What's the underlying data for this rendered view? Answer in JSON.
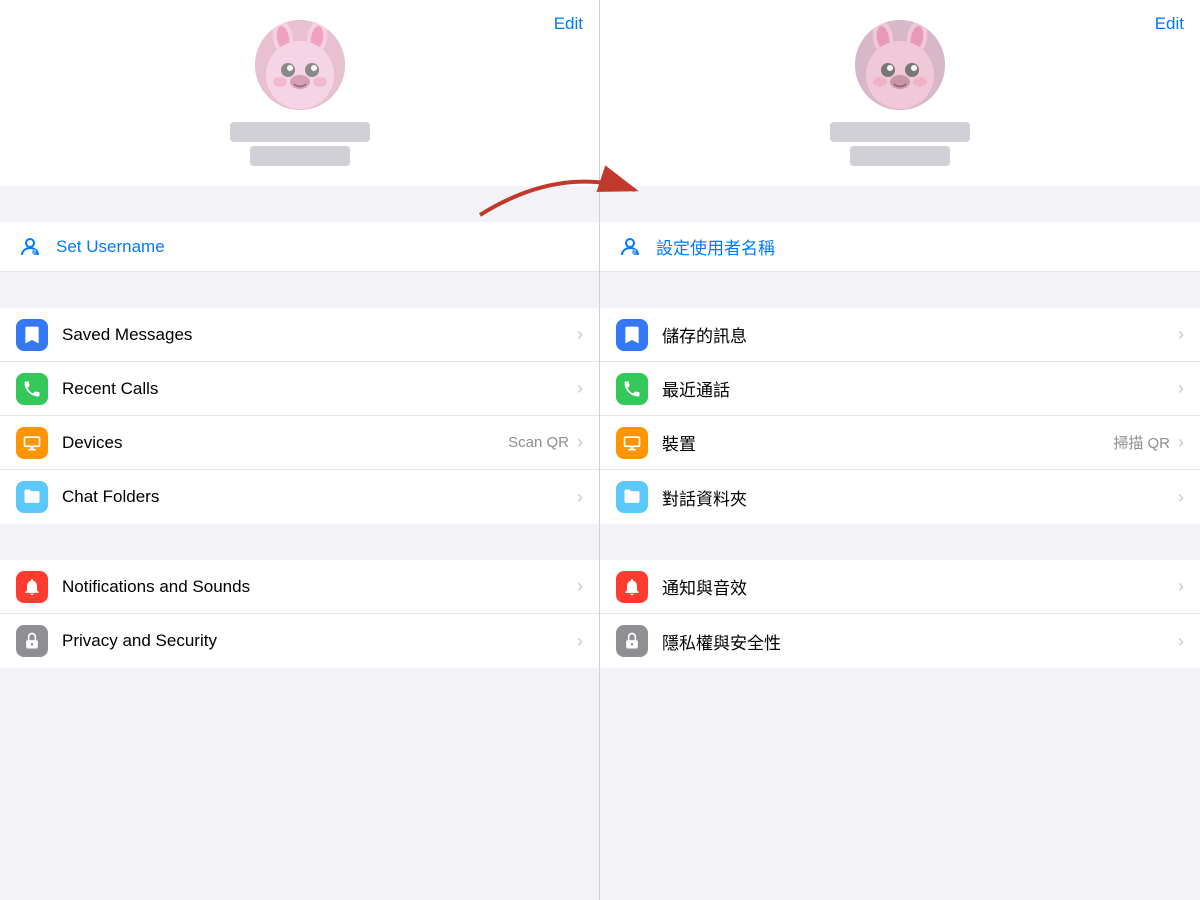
{
  "left": {
    "edit_label": "Edit",
    "username_icon": "👤",
    "username_label": "Set Username",
    "menu_groups": [
      {
        "items": [
          {
            "id": "saved-messages",
            "label": "Saved Messages",
            "icon_class": "icon-blue",
            "icon": "bookmark",
            "accessory": ""
          },
          {
            "id": "recent-calls",
            "label": "Recent Calls",
            "icon_class": "icon-green",
            "icon": "phone",
            "accessory": ""
          },
          {
            "id": "devices",
            "label": "Devices",
            "icon_class": "icon-orange",
            "icon": "laptop",
            "accessory": "Scan QR"
          },
          {
            "id": "chat-folders",
            "label": "Chat Folders",
            "icon_class": "icon-teal",
            "icon": "folder",
            "accessory": ""
          }
        ]
      },
      {
        "items": [
          {
            "id": "notifications",
            "label": "Notifications and Sounds",
            "icon_class": "icon-red",
            "icon": "bell",
            "accessory": ""
          },
          {
            "id": "privacy",
            "label": "Privacy and Security",
            "icon_class": "icon-gray",
            "icon": "lock",
            "accessory": ""
          }
        ]
      }
    ]
  },
  "right": {
    "edit_label": "Edit",
    "username_icon": "👤",
    "username_label": "設定使用者名稱",
    "menu_groups": [
      {
        "items": [
          {
            "id": "saved-messages-r",
            "label": "儲存的訊息",
            "icon_class": "icon-blue",
            "icon": "bookmark",
            "accessory": ""
          },
          {
            "id": "recent-calls-r",
            "label": "最近通話",
            "icon_class": "icon-green",
            "icon": "phone",
            "accessory": ""
          },
          {
            "id": "devices-r",
            "label": "裝置",
            "icon_class": "icon-orange",
            "icon": "laptop",
            "accessory": "掃描 QR"
          },
          {
            "id": "chat-folders-r",
            "label": "對話資料夾",
            "icon_class": "icon-teal",
            "icon": "folder",
            "accessory": ""
          }
        ]
      },
      {
        "items": [
          {
            "id": "notifications-r",
            "label": "通知與音效",
            "icon_class": "icon-red",
            "icon": "bell",
            "accessory": ""
          },
          {
            "id": "privacy-r",
            "label": "隱私權與安全性",
            "icon_class": "icon-gray",
            "icon": "lock",
            "accessory": ""
          }
        ]
      }
    ]
  }
}
